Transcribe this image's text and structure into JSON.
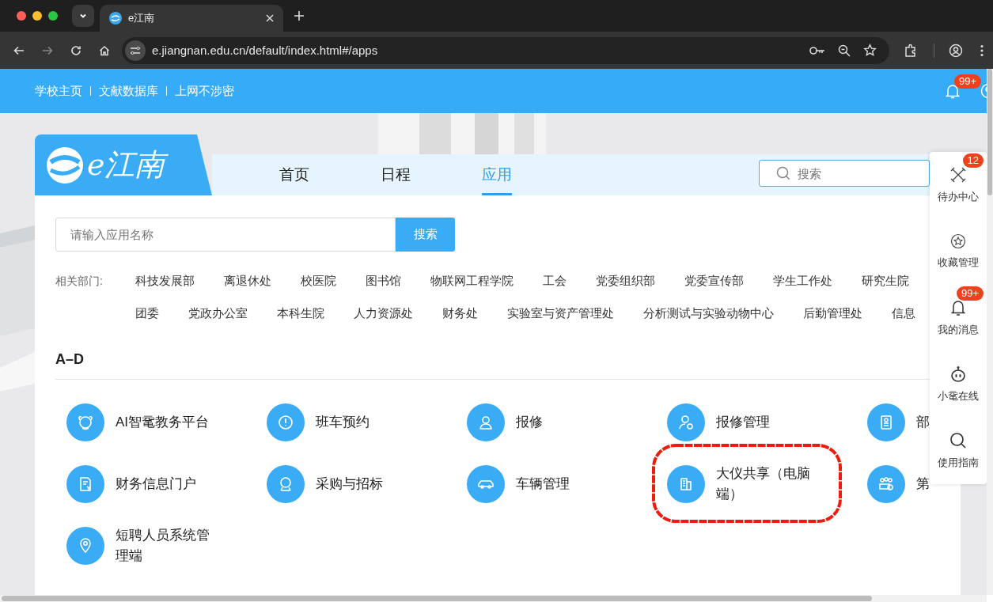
{
  "browser": {
    "tab_title": "e江南",
    "url": "e.jiangnan.edu.cn/default/index.html#/apps"
  },
  "top_links": [
    "学校主页",
    "文献数据库",
    "上网不涉密"
  ],
  "notification_badge": "99+",
  "logo": "e江南",
  "nav": [
    {
      "label": "首页",
      "selected": false
    },
    {
      "label": "日程",
      "selected": false
    },
    {
      "label": "应用",
      "selected": true
    }
  ],
  "header_search": {
    "placeholder": "搜索"
  },
  "app_search": {
    "placeholder": "请输入应用名称",
    "button": "搜索"
  },
  "departments": {
    "label": "相关部门:",
    "items": [
      "科技发展部",
      "离退休处",
      "校医院",
      "图书馆",
      "物联网工程学院",
      "工会",
      "党委组织部",
      "党委宣传部",
      "学生工作处",
      "研究生院",
      "团委",
      "党政办公室",
      "本科生院",
      "人力资源处",
      "财务处",
      "实验室与资产管理处",
      "分析测试与实验动物中心",
      "后勤管理处",
      "信息"
    ]
  },
  "section": "A–D",
  "apps": [
    {
      "name": "AI智鼋教务平台",
      "highlighted": false
    },
    {
      "name": "班车预约",
      "highlighted": false
    },
    {
      "name": "报修",
      "highlighted": false
    },
    {
      "name": "报修管理",
      "highlighted": false
    },
    {
      "name": "部",
      "highlighted": false
    },
    {
      "name": "财务信息门户",
      "highlighted": false
    },
    {
      "name": "采购与招标",
      "highlighted": false
    },
    {
      "name": "车辆管理",
      "highlighted": false
    },
    {
      "name": "大仪共享（电脑端）",
      "highlighted": true
    },
    {
      "name": "第",
      "highlighted": false
    },
    {
      "name": "短聘人员系统管理端",
      "highlighted": false
    }
  ],
  "sidebar": [
    {
      "label": "待办中心",
      "badge": "12"
    },
    {
      "label": "收藏管理"
    },
    {
      "label": "我的消息",
      "badge": "99+"
    },
    {
      "label": "小鼋在线"
    },
    {
      "label": "使用指南"
    }
  ]
}
